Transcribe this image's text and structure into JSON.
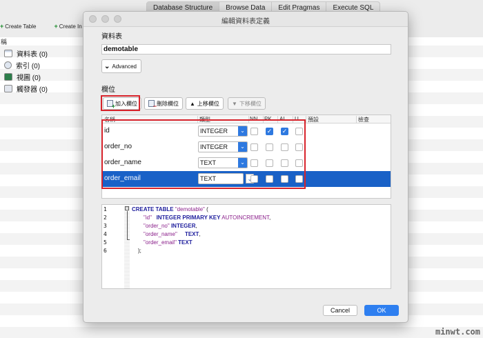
{
  "app": {
    "tabs": [
      {
        "label": "Database Structure",
        "active": true
      },
      {
        "label": "Browse Data",
        "active": false
      },
      {
        "label": "Edit Pragmas",
        "active": false
      },
      {
        "label": "Execute SQL",
        "active": false
      }
    ],
    "toolbar": {
      "create_table": "Create Table",
      "create_index": "Create In"
    },
    "tree_header": "稱",
    "tree": [
      {
        "icon": "table-icon",
        "label": "資料表 (0)"
      },
      {
        "icon": "index-icon",
        "label": "索引 (0)"
      },
      {
        "icon": "view-icon",
        "label": "視圖 (0)"
      },
      {
        "icon": "trigger-icon",
        "label": "觸發器 (0)"
      }
    ]
  },
  "dialog": {
    "title": "編輯資料表定義",
    "table_label": "資料表",
    "table_name": "demotable",
    "advanced_label": "Advanced",
    "fields_label": "欄位",
    "buttons": {
      "add_field": "加入欄位",
      "remove_field": "刪除欄位",
      "move_up": "上移欄位",
      "move_down": "下移欄位"
    },
    "columns": {
      "name": "名稱",
      "type": "類型",
      "nn": "NN",
      "pk": "PK",
      "ai": "AI",
      "u": "U",
      "default": "預設",
      "check": "檢查"
    },
    "fields": [
      {
        "name": "id",
        "type": "INTEGER",
        "nn": false,
        "pk": true,
        "ai": true,
        "u": false,
        "selected": false
      },
      {
        "name": "order_no",
        "type": "INTEGER",
        "nn": false,
        "pk": false,
        "ai": false,
        "u": false,
        "selected": false
      },
      {
        "name": "order_name",
        "type": "TEXT",
        "nn": false,
        "pk": false,
        "ai": false,
        "u": false,
        "selected": false
      },
      {
        "name": "order_email",
        "type": "TEXT",
        "nn": false,
        "pk": false,
        "ai": false,
        "u": false,
        "selected": true
      }
    ],
    "sql": {
      "line_numbers": [
        "1",
        "2",
        "3",
        "4",
        "5",
        "6"
      ],
      "l1_kw": "CREATE TABLE",
      "l1_name": "\"demotable\"",
      "l1_paren": " (",
      "l2_name": "\"id\"",
      "l2_kw": "INTEGER PRIMARY KEY",
      "l2_ai": "AUTOINCREMENT",
      "l2_comma": ",",
      "l3_name": "\"order_no\"",
      "l3_kw": "INTEGER",
      "l3_comma": ",",
      "l4_name": "\"order_name\"",
      "l4_kw": "TEXT",
      "l4_comma": ",",
      "l5_name": "\"order_email\"",
      "l5_kw": "TEXT",
      "l6": ");"
    },
    "cancel_label": "Cancel",
    "ok_label": "OK"
  },
  "watermark": "minwt.com",
  "colors": {
    "highlight_border": "#d7232b",
    "selection": "#1961c7",
    "accent": "#2e7ff0"
  }
}
